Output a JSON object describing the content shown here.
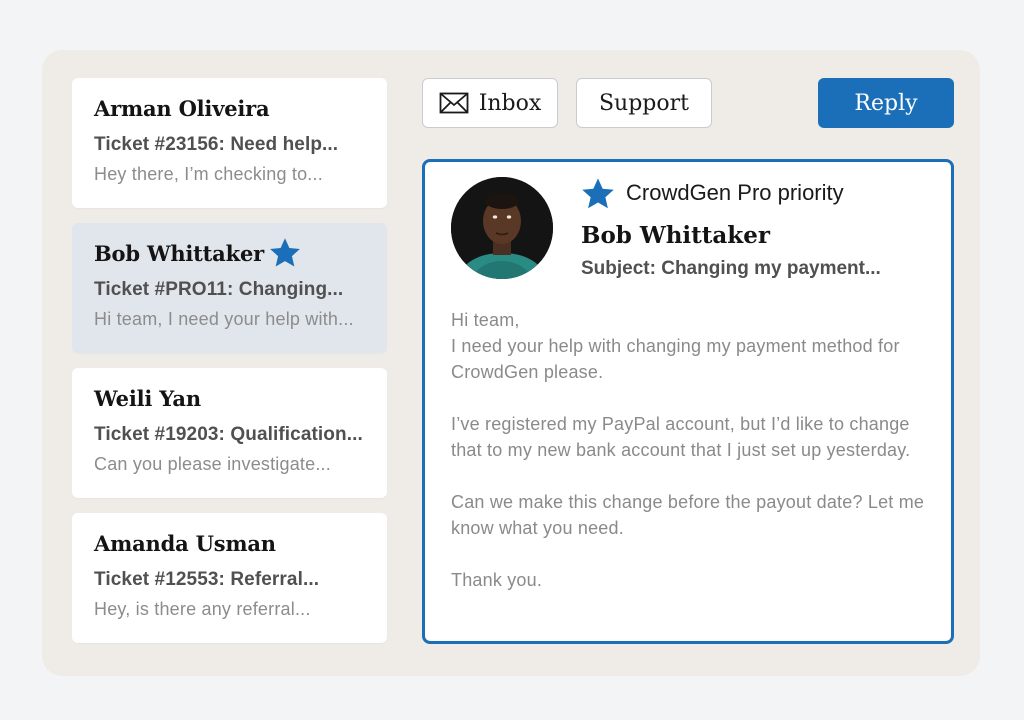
{
  "colors": {
    "accent": "#1a6fb8",
    "panel_background": "#efece7",
    "page_background": "#f3f4f6",
    "selected_row": "#e1e6ec"
  },
  "tickets": [
    {
      "name": "Arman Oliveira",
      "subject": "Ticket #23156: Need help...",
      "preview": "Hey there, I’m checking to...",
      "starred": false,
      "selected": false
    },
    {
      "name": "Bob Whittaker",
      "subject": "Ticket #PRO11: Changing...",
      "preview": "Hi team, I need your help with...",
      "starred": true,
      "selected": true
    },
    {
      "name": "Weili Yan",
      "subject": "Ticket #19203: Qualification...",
      "preview": "Can you please investigate...",
      "starred": false,
      "selected": false
    },
    {
      "name": "Amanda Usman",
      "subject": "Ticket #12553: Referral...",
      "preview": "Hey, is there any referral...",
      "starred": false,
      "selected": false
    }
  ],
  "toolbar": {
    "inbox_label": "Inbox",
    "inbox_icon": "envelope-icon",
    "support_label": "Support",
    "reply_label": "Reply"
  },
  "detail": {
    "priority_label": "CrowdGen Pro priority",
    "priority_icon": "star-icon",
    "sender": "Bob Whittaker",
    "subject": "Subject: Changing my payment...",
    "body": [
      "Hi team,\nI need your help with changing my payment method for CrowdGen please.",
      "I’ve registered my PayPal account, but I’d like to change that to my new bank account that I just set up yesterday.",
      "Can we make this change before the payout date? Let me know what you need.",
      "Thank you."
    ]
  }
}
